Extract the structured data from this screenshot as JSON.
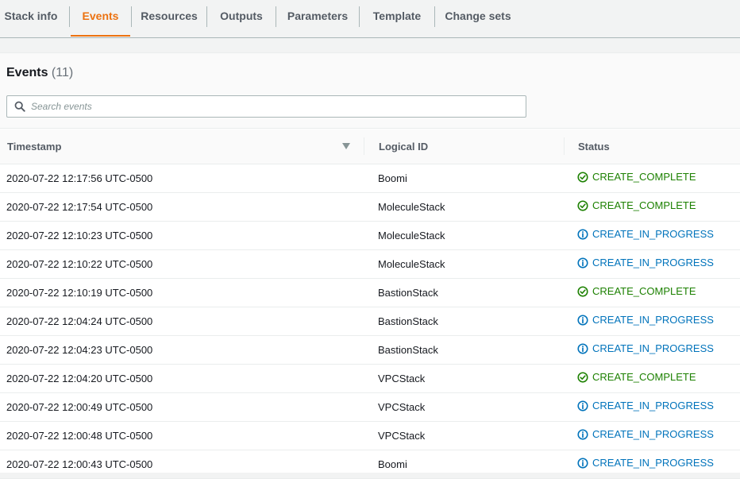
{
  "tabs": [
    {
      "label": "Stack info",
      "active": false
    },
    {
      "label": "Events",
      "active": true
    },
    {
      "label": "Resources",
      "active": false
    },
    {
      "label": "Outputs",
      "active": false
    },
    {
      "label": "Parameters",
      "active": false
    },
    {
      "label": "Template",
      "active": false
    },
    {
      "label": "Change sets",
      "active": false
    }
  ],
  "events": {
    "title": "Events",
    "count": "(11)",
    "search_placeholder": "Search events",
    "columns": {
      "timestamp": "Timestamp",
      "logical_id": "Logical ID",
      "status": "Status"
    },
    "rows": [
      {
        "timestamp": "2020-07-22 12:17:56 UTC-0500",
        "logical_id": "Boomi",
        "status": "CREATE_COMPLETE",
        "kind": "complete"
      },
      {
        "timestamp": "2020-07-22 12:17:54 UTC-0500",
        "logical_id": "MoleculeStack",
        "status": "CREATE_COMPLETE",
        "kind": "complete"
      },
      {
        "timestamp": "2020-07-22 12:10:23 UTC-0500",
        "logical_id": "MoleculeStack",
        "status": "CREATE_IN_PROGRESS",
        "kind": "progress"
      },
      {
        "timestamp": "2020-07-22 12:10:22 UTC-0500",
        "logical_id": "MoleculeStack",
        "status": "CREATE_IN_PROGRESS",
        "kind": "progress"
      },
      {
        "timestamp": "2020-07-22 12:10:19 UTC-0500",
        "logical_id": "BastionStack",
        "status": "CREATE_COMPLETE",
        "kind": "complete"
      },
      {
        "timestamp": "2020-07-22 12:04:24 UTC-0500",
        "logical_id": "BastionStack",
        "status": "CREATE_IN_PROGRESS",
        "kind": "progress"
      },
      {
        "timestamp": "2020-07-22 12:04:23 UTC-0500",
        "logical_id": "BastionStack",
        "status": "CREATE_IN_PROGRESS",
        "kind": "progress"
      },
      {
        "timestamp": "2020-07-22 12:04:20 UTC-0500",
        "logical_id": "VPCStack",
        "status": "CREATE_COMPLETE",
        "kind": "complete"
      },
      {
        "timestamp": "2020-07-22 12:00:49 UTC-0500",
        "logical_id": "VPCStack",
        "status": "CREATE_IN_PROGRESS",
        "kind": "progress"
      },
      {
        "timestamp": "2020-07-22 12:00:48 UTC-0500",
        "logical_id": "VPCStack",
        "status": "CREATE_IN_PROGRESS",
        "kind": "progress"
      },
      {
        "timestamp": "2020-07-22 12:00:43 UTC-0500",
        "logical_id": "Boomi",
        "status": "CREATE_IN_PROGRESS",
        "kind": "progress"
      }
    ]
  },
  "colors": {
    "accent": "#ec7211",
    "complete": "#1d8102",
    "progress": "#0073bb"
  },
  "icons": {
    "search": "search-icon",
    "sort": "caret-down-icon",
    "complete": "check-circle-icon",
    "progress": "info-circle-icon"
  }
}
